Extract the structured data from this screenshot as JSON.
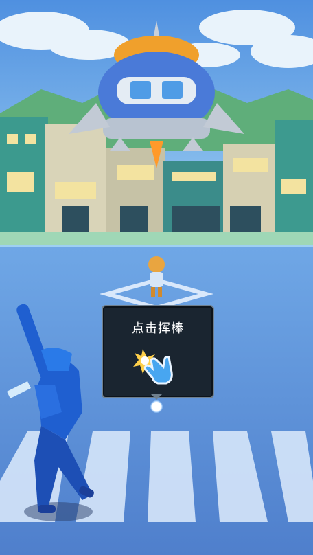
{
  "tutorial": {
    "prompt": "点击挥棒",
    "icon": "tap-hand-icon"
  },
  "scene": {
    "sky_color": "#5a9be0",
    "ground_color": "#6a9be2",
    "ufo_color": "#f08a24",
    "batter_color": "#1f5fd0"
  }
}
